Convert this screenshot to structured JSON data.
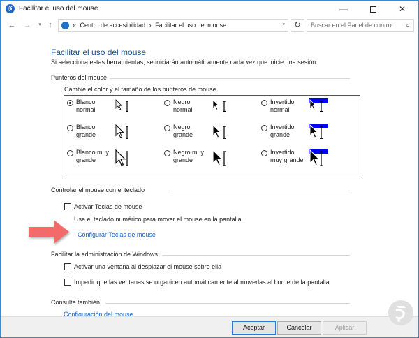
{
  "window": {
    "title": "Facilitar el uso del mouse",
    "controls": {
      "minimize": "—",
      "maximize": "",
      "close": "✕"
    }
  },
  "nav": {
    "back": "←",
    "forward": "→",
    "dropdown": "▾",
    "up": "↑",
    "breadcrumbs": [
      "«",
      "Centro de accesibilidad",
      "›",
      "Facilitar el uso del mouse"
    ],
    "address_dropdown": "▾",
    "refresh": "↻",
    "search_placeholder": "Buscar en el Panel de control"
  },
  "page": {
    "title": "Facilitar el uso del mouse",
    "subtitle": "Si selecciona estas herramientas, se iniciarán automáticamente cada vez que inicie una sesión."
  },
  "pointers": {
    "heading": "Punteros del mouse",
    "description": "Cambie el color y el tamaño de los punteros de mouse.",
    "options": [
      {
        "label1": "Blanco",
        "label2": "normal",
        "selected": true,
        "style": "white",
        "size": "normal"
      },
      {
        "label1": "Negro",
        "label2": "normal",
        "selected": false,
        "style": "black",
        "size": "normal"
      },
      {
        "label1": "Invertido",
        "label2": "normal",
        "selected": false,
        "style": "inverted",
        "size": "normal"
      },
      {
        "label1": "Blanco",
        "label2": "grande",
        "selected": false,
        "style": "white",
        "size": "large"
      },
      {
        "label1": "Negro",
        "label2": "grande",
        "selected": false,
        "style": "black",
        "size": "large"
      },
      {
        "label1": "Invertido",
        "label2": "grande",
        "selected": false,
        "style": "inverted",
        "size": "large"
      },
      {
        "label1": "Blanco muy",
        "label2": "grande",
        "selected": false,
        "style": "white",
        "size": "xlarge"
      },
      {
        "label1": "Negro muy",
        "label2": "grande",
        "selected": false,
        "style": "black",
        "size": "xlarge"
      },
      {
        "label1": "Invertido",
        "label2": "muy grande",
        "selected": false,
        "style": "inverted",
        "size": "xlarge"
      }
    ]
  },
  "keyboard": {
    "heading": "Controlar el mouse con el teclado",
    "checkbox_label": "Activar Teclas de mouse",
    "checked": false,
    "help": "Use el teclado numérico para mover el mouse en la pantalla.",
    "link": "Configurar Teclas de mouse"
  },
  "windows_mgmt": {
    "heading": "Facilitar la administración de Windows",
    "options": [
      {
        "label": "Activar una ventana al desplazar el mouse sobre ella",
        "checked": false
      },
      {
        "label": "Impedir que las ventanas se organicen automáticamente al moverlas al borde de la pantalla",
        "checked": false
      }
    ]
  },
  "see_also": {
    "heading": "Consulte también",
    "link": "Configuración del mouse"
  },
  "footer": {
    "ok": "Aceptar",
    "cancel": "Cancelar",
    "apply": "Aplicar"
  },
  "colors": {
    "accent": "#1e64c0",
    "title_blue": "#1e4f8f",
    "arrow_red": "#f26b6b",
    "inverted_blue": "#0000ff"
  }
}
